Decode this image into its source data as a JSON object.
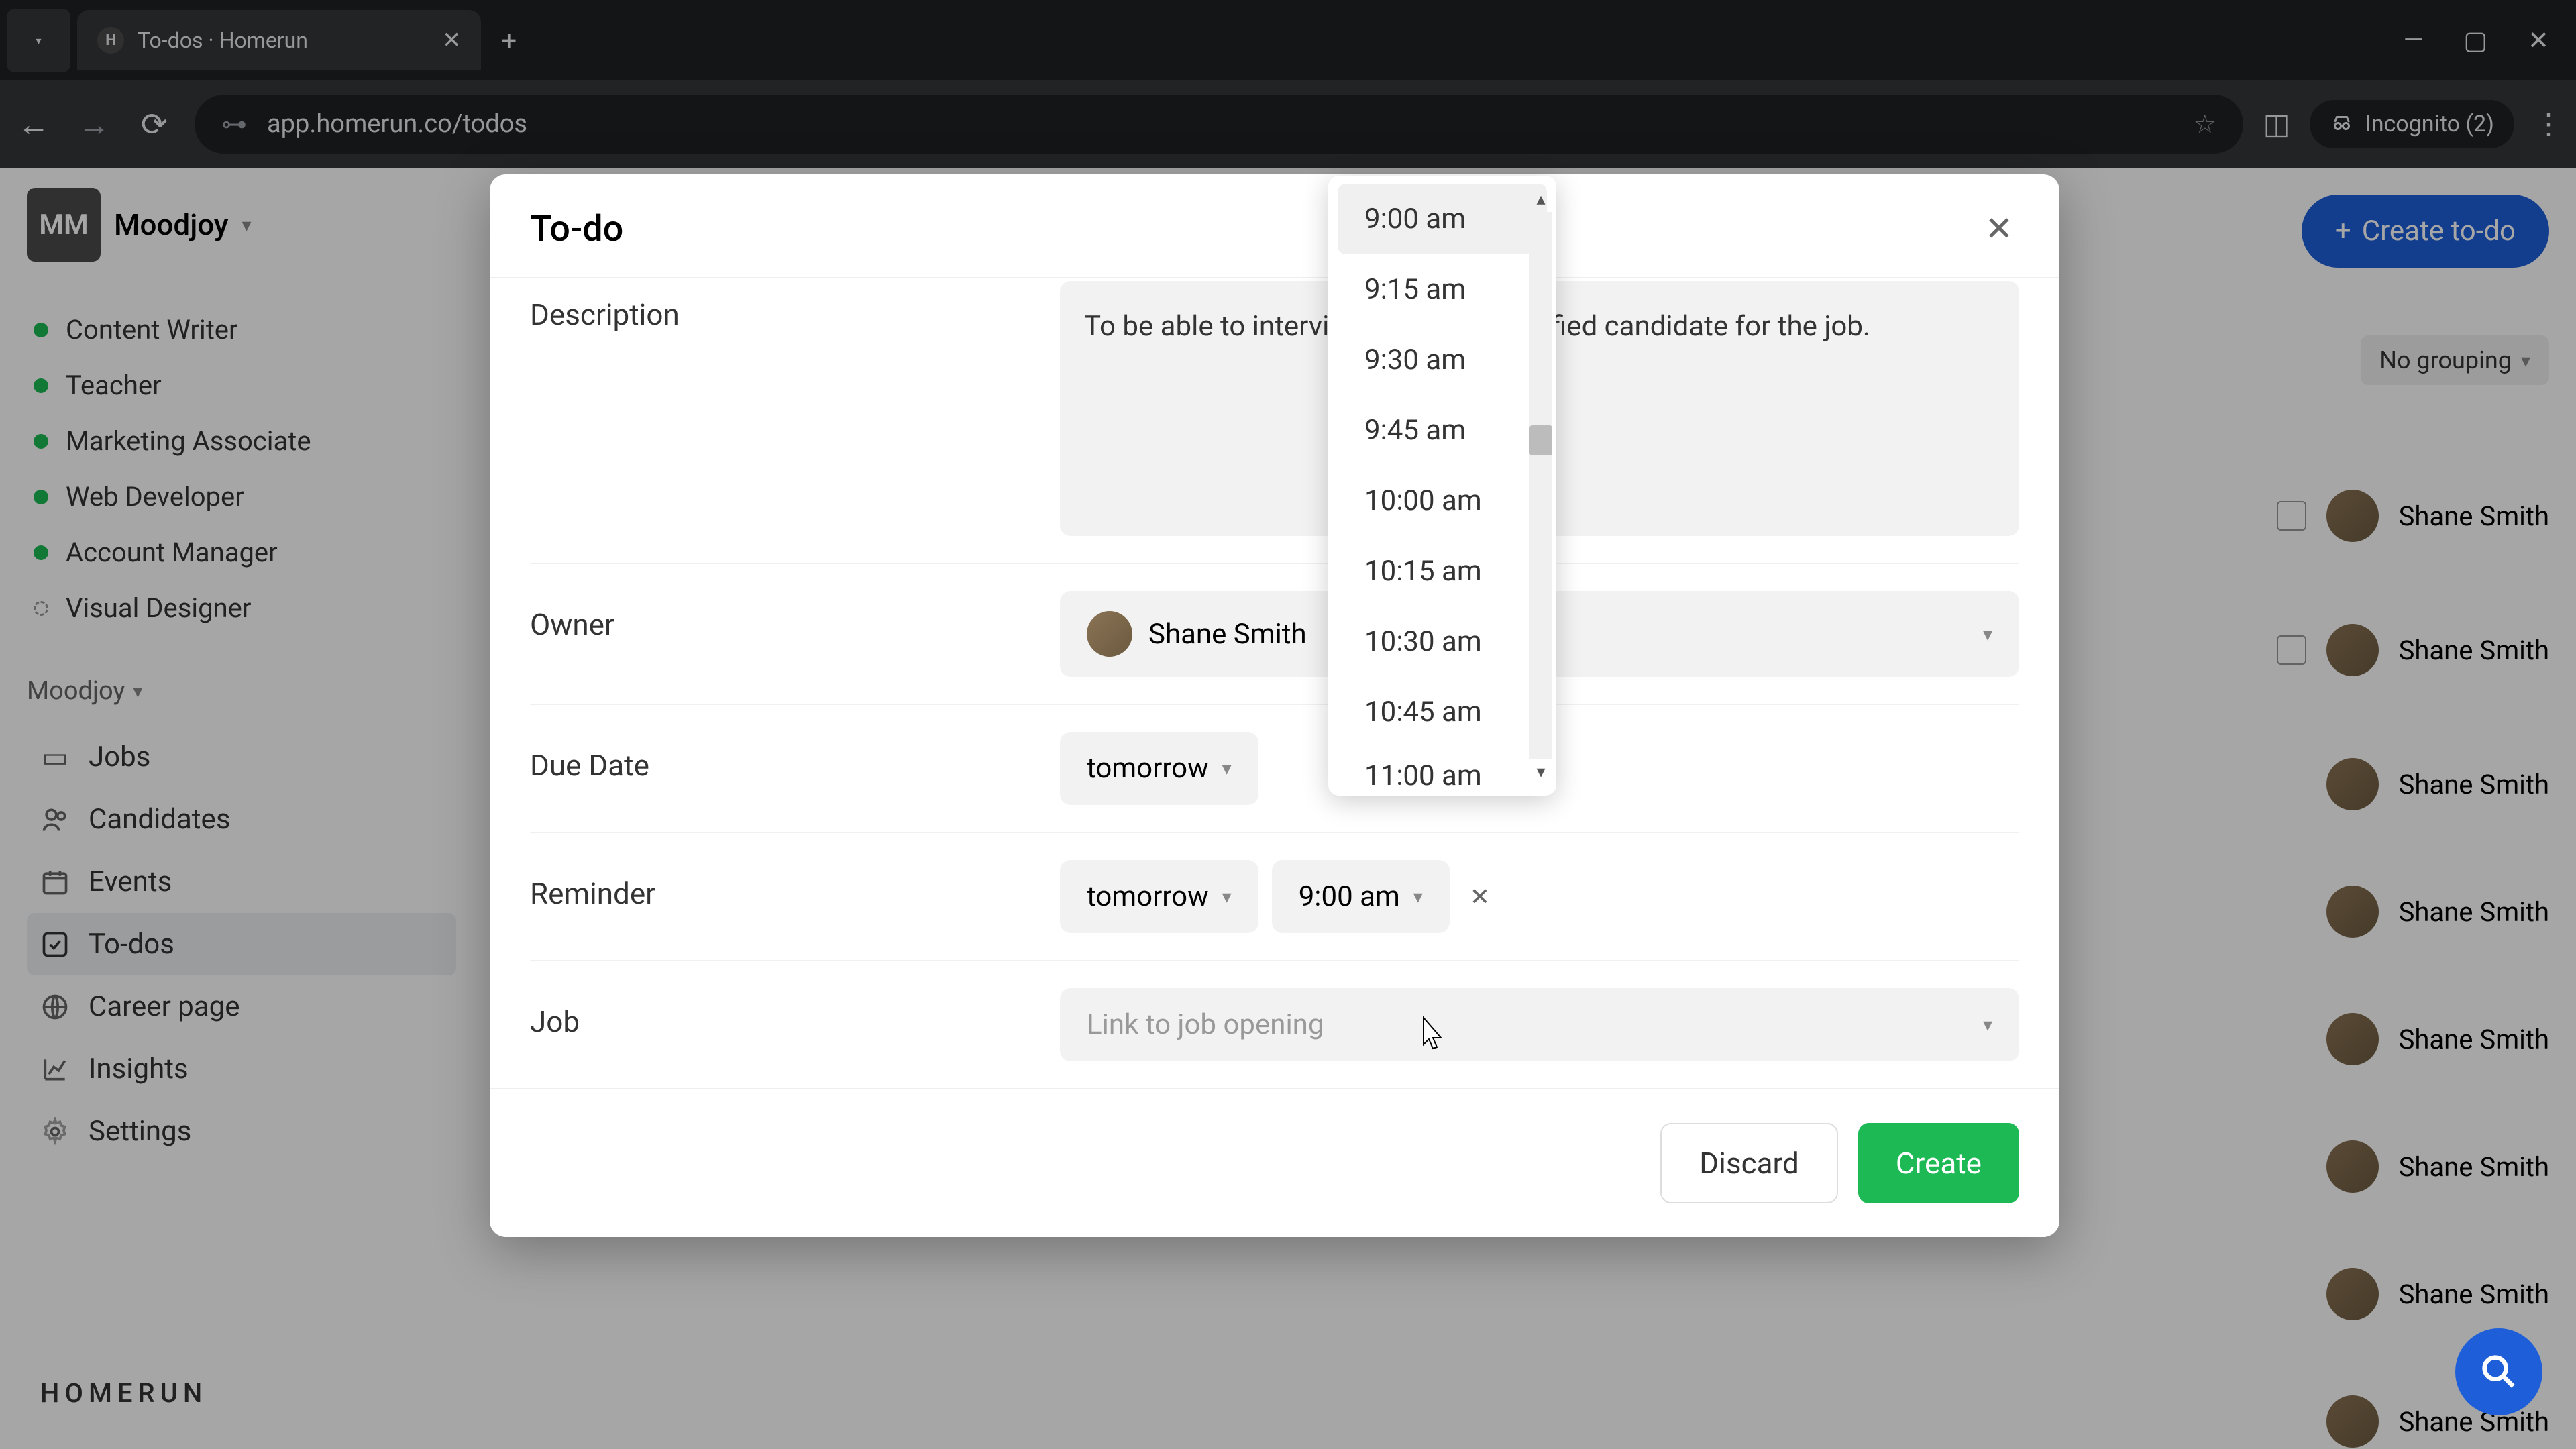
{
  "browser": {
    "tab_title": "To-dos · Homerun",
    "url": "app.homerun.co/todos",
    "incognito_label": "Incognito (2)",
    "favicon_letter": "H"
  },
  "workspace": {
    "avatar_initials": "MM",
    "name": "Moodjoy"
  },
  "jobs": [
    "Content Writer",
    "Teacher",
    "Marketing Associate",
    "Web Developer",
    "Account Manager",
    "Visual Designer"
  ],
  "nav_section_label": "Moodjoy",
  "nav_items": [
    "Jobs",
    "Candidates",
    "Events",
    "To-dos",
    "Career page",
    "Insights",
    "Settings"
  ],
  "nav_active_index": 3,
  "logo_text": "HOMERUN",
  "header": {
    "create_button": "Create to-do",
    "grouping": "No grouping"
  },
  "task_owner_name": "Shane Smith",
  "modal": {
    "title": "To-do",
    "labels": {
      "description": "Description",
      "owner": "Owner",
      "due_date": "Due Date",
      "reminder": "Reminder",
      "job": "Job"
    },
    "description_value": "To be able to interview the most qualified candidate for the job.",
    "owner_value": "Shane Smith",
    "due_date_value": "tomorrow",
    "reminder_date_value": "tomorrow",
    "reminder_time_value": "9:00 am",
    "job_placeholder": "Link to job opening",
    "discard": "Discard",
    "create": "Create"
  },
  "time_options": [
    "9:00 am",
    "9:15 am",
    "9:30 am",
    "9:45 am",
    "10:00 am",
    "10:15 am",
    "10:30 am",
    "10:45 am",
    "11:00 am"
  ],
  "time_selected_index": 0
}
